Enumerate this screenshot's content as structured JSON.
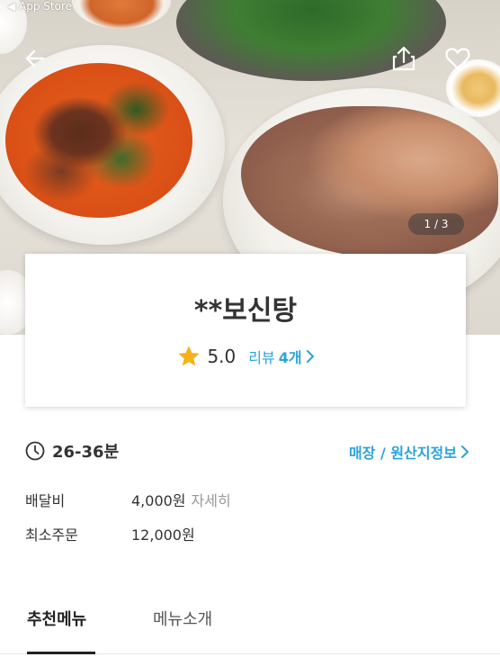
{
  "status_bar": {
    "back_label": "◀ App Store"
  },
  "hero": {
    "pager_text": "1 / 3",
    "back_icon": "arrow-left-icon",
    "share_icon": "share-icon",
    "like_icon": "heart-outline-icon"
  },
  "store": {
    "name": "**보신탕",
    "rating": "5.0",
    "review_label": "리뷰",
    "review_count": "4개",
    "accent_color": "#2aa3d9",
    "star_color": "#f6b21b"
  },
  "delivery": {
    "time": "26-36분",
    "store_info_link": "매장 / 원산지정보",
    "fee_label": "배달비",
    "fee_value": "4,000원",
    "fee_detail": "자세히",
    "min_order_label": "최소주문",
    "min_order_value": "12,000원"
  },
  "tabs": [
    {
      "label": "추천메뉴",
      "active": true
    },
    {
      "label": "메뉴소개",
      "active": false
    }
  ]
}
